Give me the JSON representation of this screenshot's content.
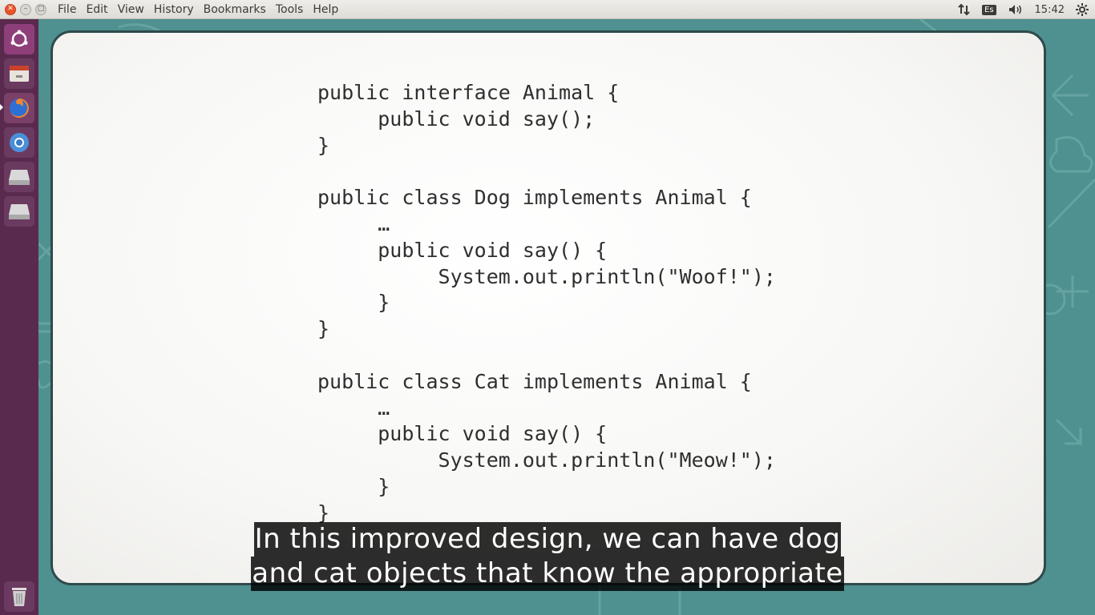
{
  "menubar": {
    "items": [
      "File",
      "Edit",
      "View",
      "History",
      "Bookmarks",
      "Tools",
      "Help"
    ]
  },
  "tray": {
    "keyboard_layout": "Es",
    "clock": "15:42",
    "icons": [
      "network-updown-icon",
      "volume-icon",
      "settings-gear-icon"
    ]
  },
  "launcher": {
    "items": [
      "ubuntu-dash-icon",
      "files-icon",
      "firefox-icon",
      "chromium-icon",
      "drive-icon",
      "drive-icon",
      "trash-icon"
    ],
    "active": "firefox-icon"
  },
  "slide": {
    "code_lines": [
      "public interface Animal {",
      "     public void say();",
      "}",
      "",
      "public class Dog implements Animal {",
      "     …",
      "     public void say() {",
      "          System.out.println(\"Woof!\");",
      "     }",
      "}",
      "",
      "public class Cat implements Animal {",
      "     …",
      "     public void say() {",
      "          System.out.println(\"Meow!\");",
      "     }",
      "}"
    ]
  },
  "subtitles": {
    "line1": "In this improved design, we can have dog",
    "line2": "and cat objects that know the appropriate"
  },
  "colors": {
    "launcher_bg": "#5a2a4e",
    "video_bg": "#4f9090",
    "close_button": "#e9542b"
  }
}
